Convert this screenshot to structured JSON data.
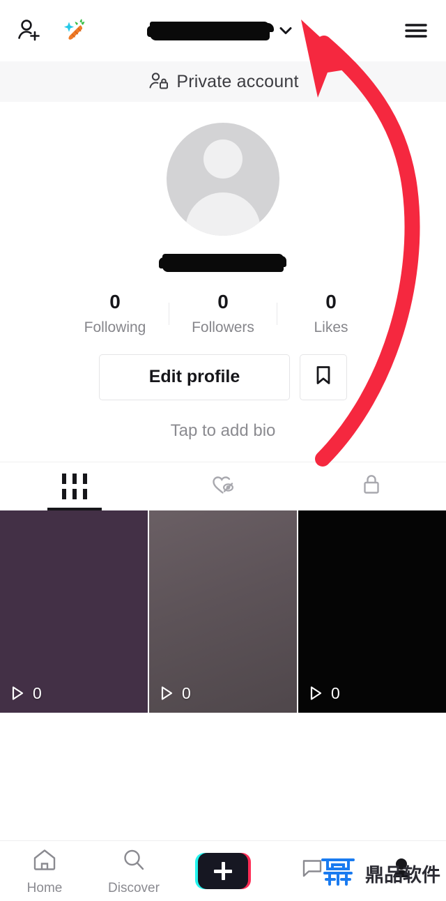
{
  "header": {
    "add_friend_icon": "add-person-icon",
    "carrot_icon": "carrot-sparkle-icon",
    "username_redacted": true,
    "chevron_icon": "chevron-down-icon",
    "menu_icon": "hamburger-menu-icon"
  },
  "private_banner": {
    "icon": "person-lock-icon",
    "label": "Private account"
  },
  "profile": {
    "avatar_icon": "default-avatar-icon",
    "handle_redacted": true,
    "bio_placeholder": "Tap to add bio",
    "stats": [
      {
        "value": "0",
        "label": "Following"
      },
      {
        "value": "0",
        "label": "Followers"
      },
      {
        "value": "0",
        "label": "Likes"
      }
    ],
    "edit_profile_label": "Edit profile",
    "bookmark_icon": "bookmark-icon"
  },
  "tabs": [
    {
      "icon": "grid-icon",
      "active": true
    },
    {
      "icon": "heart-hidden-icon",
      "active": false
    },
    {
      "icon": "lock-icon",
      "active": false
    }
  ],
  "videos": [
    {
      "plays": "0",
      "color": "#433046"
    },
    {
      "plays": "0",
      "color": "#5d5358"
    },
    {
      "plays": "0",
      "color": "#050505"
    }
  ],
  "bottom_nav": [
    {
      "icon": "home-icon",
      "label": "Home"
    },
    {
      "icon": "search-icon",
      "label": "Discover"
    },
    {
      "icon": "create-plus-icon",
      "label": ""
    },
    {
      "icon": "inbox-icon",
      "label": ""
    },
    {
      "icon": "profile-icon",
      "label": ""
    }
  ],
  "watermark": {
    "logo": "dingpin-logo-icon",
    "text": "鼎品软件"
  },
  "annotation": {
    "type": "curved-arrow",
    "color": "#f5283f",
    "points_to": "username-dropdown-chevron"
  },
  "colors": {
    "accent_red": "#f5283f",
    "tiktok_cyan": "#25f4ee",
    "tiktok_pink": "#fe2c55",
    "banner_bg": "#f7f7f8",
    "watermark_blue": "#1a7bf0"
  }
}
